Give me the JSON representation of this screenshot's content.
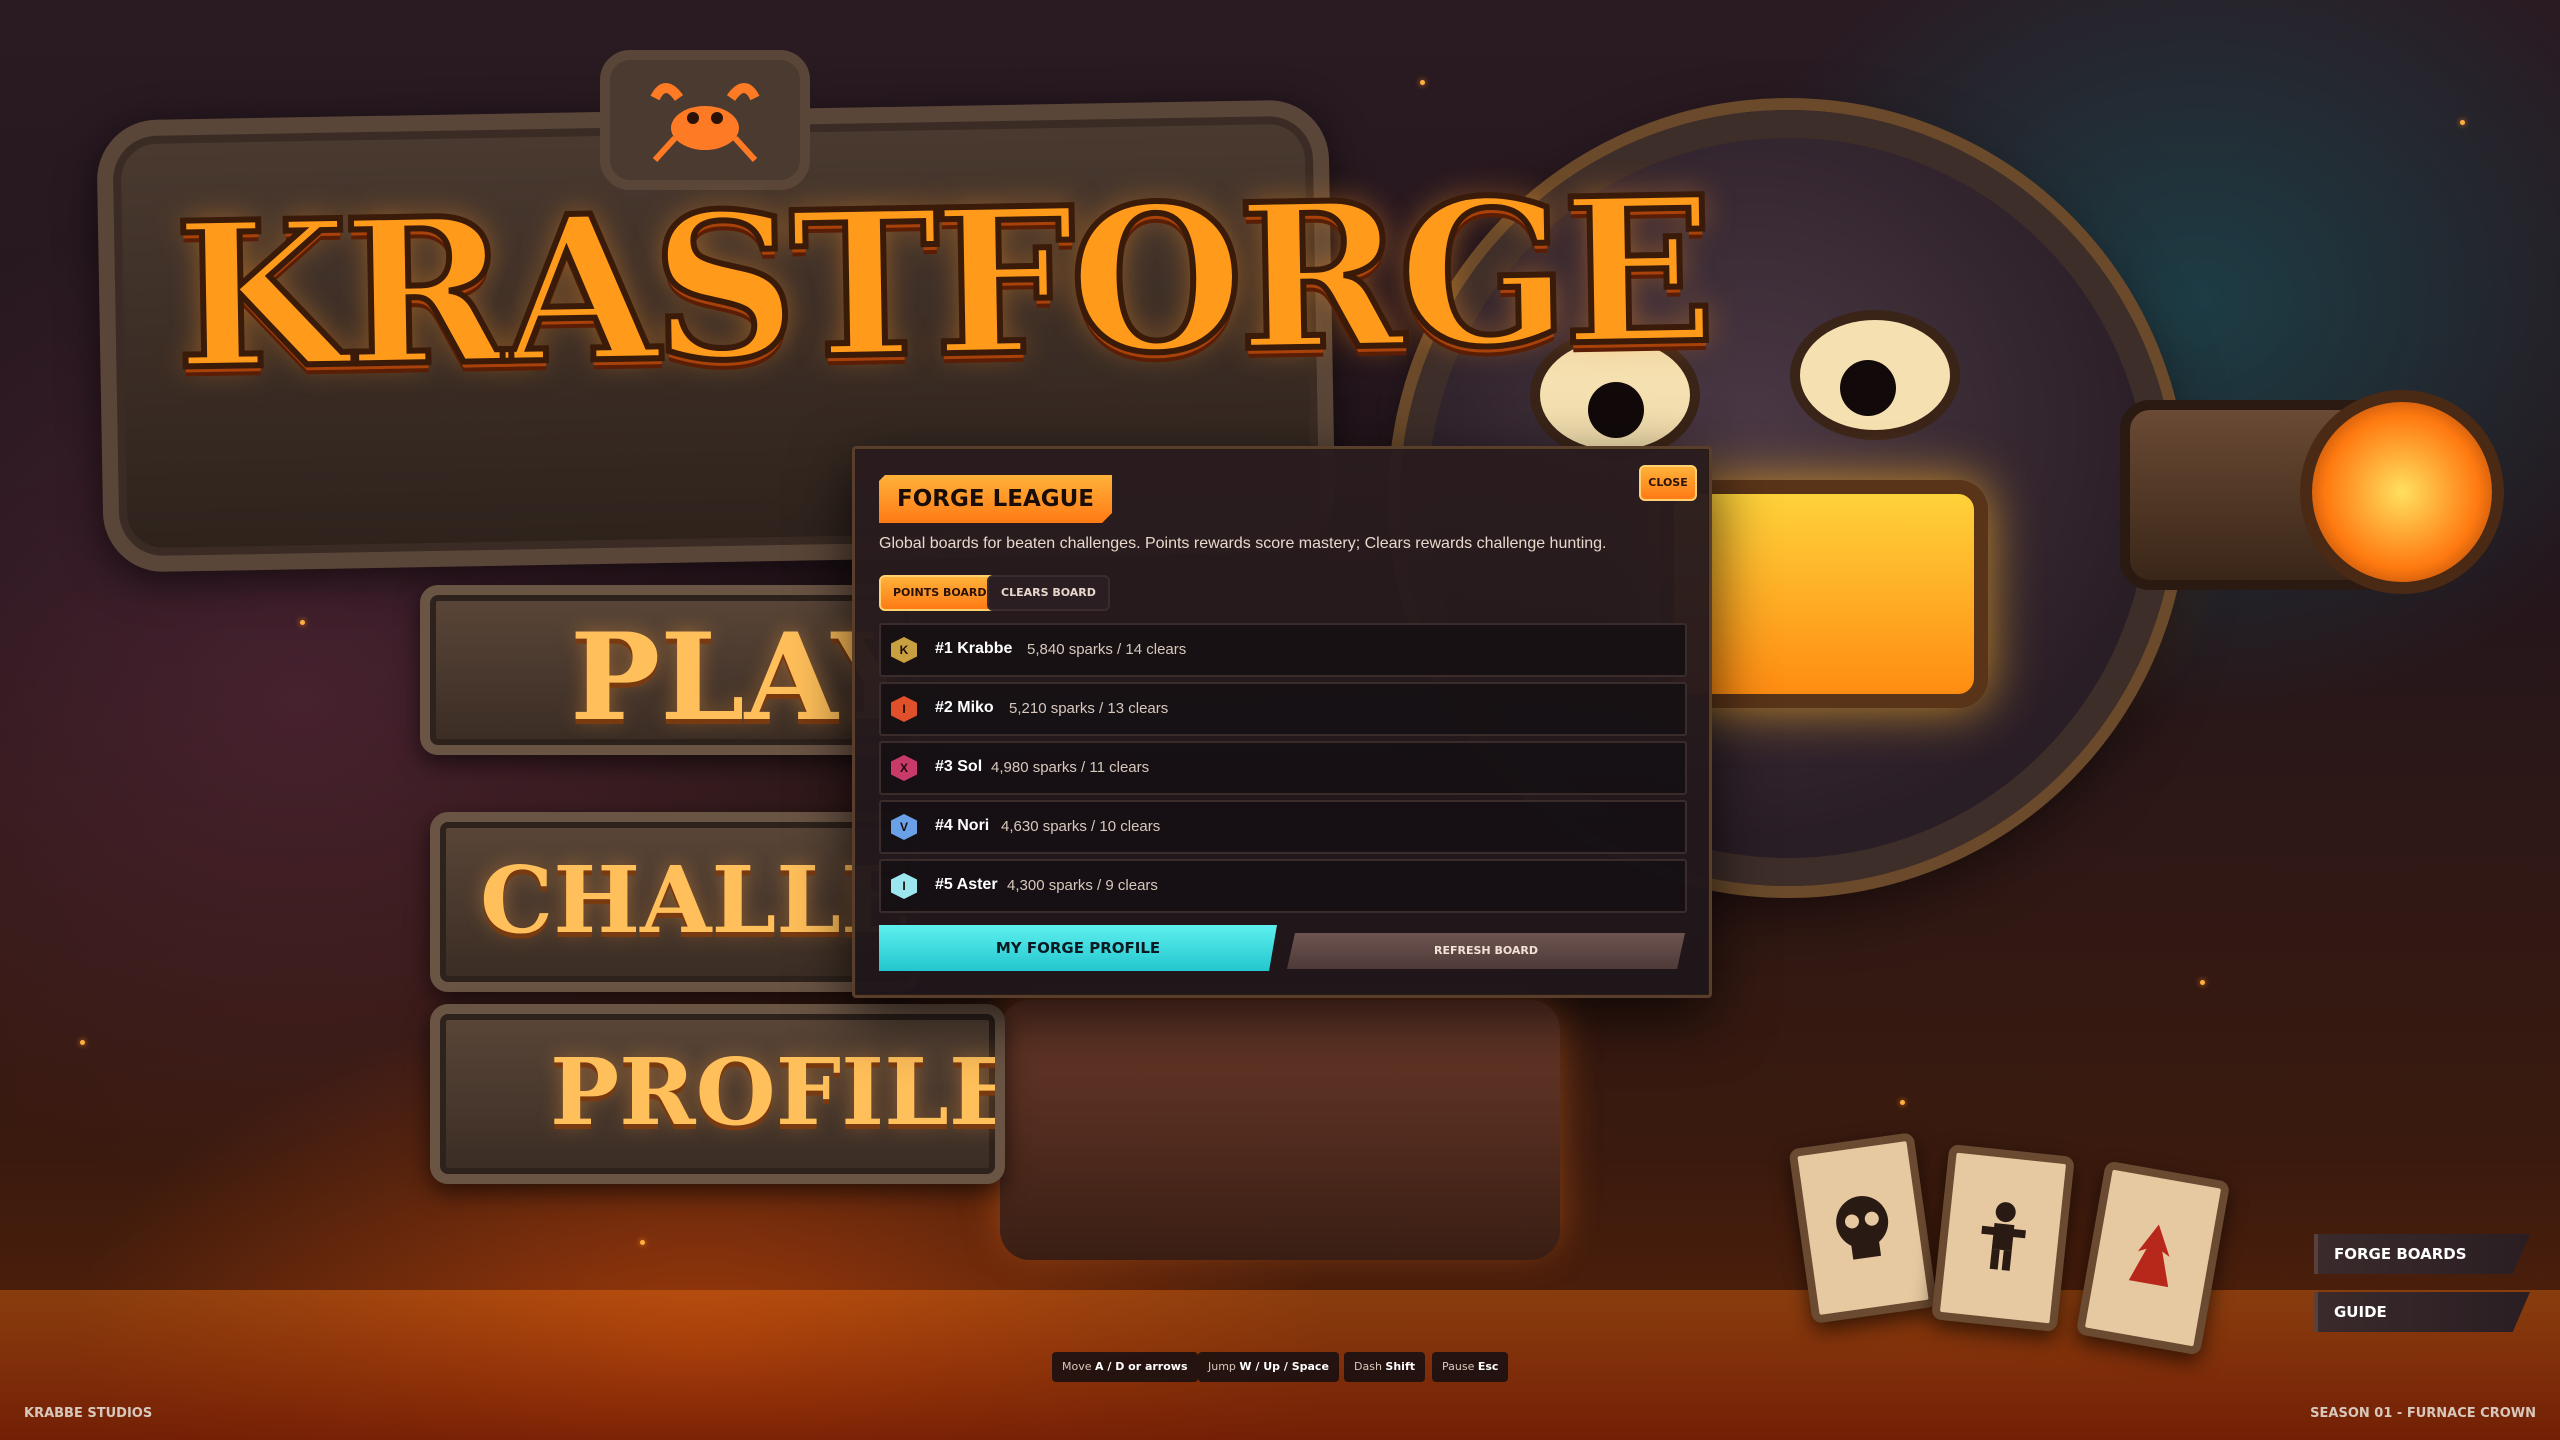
{
  "game": {
    "logo_text": "KRASTFORGE"
  },
  "menu": {
    "play": "PLAY",
    "challenges": "CHALLENGES",
    "profile": "PROFILE"
  },
  "panel": {
    "title": "FORGE LEAGUE",
    "close_label": "CLOSE",
    "description": "Global boards for beaten challenges. Points rewards score mastery; Clears rewards challenge hunting.",
    "tabs": [
      {
        "label": "POINTS BOARD",
        "active": true
      },
      {
        "label": "CLEARS BOARD",
        "active": false
      }
    ],
    "rows": [
      {
        "initial": "K",
        "name": "#1 Krabbe",
        "stats": "5,840 sparks / 14 clears",
        "color": "#c8a040"
      },
      {
        "initial": "I",
        "name": "#2 Miko",
        "stats": "5,210 sparks / 13 clears",
        "color": "#e0502a"
      },
      {
        "initial": "X",
        "name": "#3 Sol",
        "stats": "4,980 sparks / 11 clears",
        "color": "#c83a6a"
      },
      {
        "initial": "V",
        "name": "#4 Nori",
        "stats": "4,630 sparks / 10 clears",
        "color": "#6aa0e8"
      },
      {
        "initial": "I",
        "name": "#5 Aster",
        "stats": "4,300 sparks / 9 clears",
        "color": "#9ce6f0"
      }
    ],
    "primary_button": "MY FORGE PROFILE",
    "secondary_button": "REFRESH BOARD"
  },
  "side_buttons": {
    "boards": "FORGE BOARDS",
    "guide": "GUIDE"
  },
  "controls": [
    {
      "action": "Move",
      "keys": "A / D or arrows"
    },
    {
      "action": "Jump",
      "keys": "W / Up / Space"
    },
    {
      "action": "Dash",
      "keys": "Shift"
    },
    {
      "action": "Pause",
      "keys": "Esc"
    }
  ],
  "footer": {
    "studio": "KRABBE STUDIOS",
    "season": "SEASON 01 - FURNACE CROWN"
  },
  "colors": {
    "accent_orange": "#ff9a1a",
    "accent_cyan": "#2fd3d8",
    "panel_bg": "#2a1c1e"
  }
}
